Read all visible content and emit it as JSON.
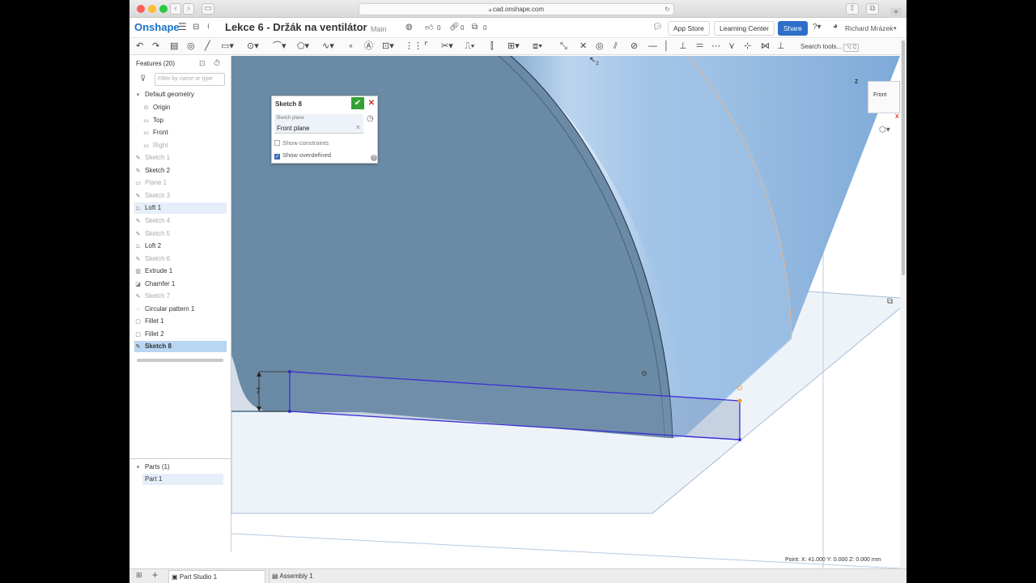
{
  "browser": {
    "url": "cad.onshape.com"
  },
  "header": {
    "logo": "Onshape",
    "title": "Lekce 6 - Držák na ventilátor",
    "branch": "Main",
    "likes": "0",
    "links": "0",
    "copies": "0",
    "app_store": "App Store",
    "learning_center": "Learning Center",
    "share": "Share",
    "user": "Richard Mrázek"
  },
  "toolbar": {
    "search_placeholder": "Search tools...",
    "search_shortcut": "⌥ C",
    "cursor_subscript": "2"
  },
  "features": {
    "title": "Features (20)",
    "filter_placeholder": "Filter by name or type",
    "default_geometry": "Default geometry",
    "items": [
      {
        "label": "Origin",
        "icon": "origin-icon",
        "state": "normal",
        "indent": 2
      },
      {
        "label": "Top",
        "icon": "plane-icon",
        "state": "normal",
        "indent": 2
      },
      {
        "label": "Front",
        "icon": "plane-icon",
        "state": "normal",
        "indent": 2
      },
      {
        "label": "Right",
        "icon": "plane-icon",
        "state": "dim",
        "indent": 2
      },
      {
        "label": "Sketch 1",
        "icon": "sketch-icon",
        "state": "dim",
        "indent": 0
      },
      {
        "label": "Sketch 2",
        "icon": "sketch-icon",
        "state": "normal",
        "indent": 0
      },
      {
        "label": "Plane 1",
        "icon": "plane-icon",
        "state": "dim",
        "indent": 0
      },
      {
        "label": "Sketch 3",
        "icon": "sketch-icon",
        "state": "dim",
        "indent": 0
      },
      {
        "label": "Loft 1",
        "icon": "loft-icon",
        "state": "hl",
        "indent": 0
      },
      {
        "label": "Sketch 4",
        "icon": "sketch-icon",
        "state": "dim",
        "indent": 0
      },
      {
        "label": "Sketch 5",
        "icon": "sketch-icon",
        "state": "dim",
        "indent": 0
      },
      {
        "label": "Loft 2",
        "icon": "loft-icon",
        "state": "normal",
        "indent": 0
      },
      {
        "label": "Sketch 6",
        "icon": "sketch-icon",
        "state": "dim",
        "indent": 0
      },
      {
        "label": "Extrude 1",
        "icon": "extrude-icon",
        "state": "normal",
        "indent": 0
      },
      {
        "label": "Chamfer 1",
        "icon": "chamfer-icon",
        "state": "normal",
        "indent": 0
      },
      {
        "label": "Sketch 7",
        "icon": "sketch-icon",
        "state": "dim",
        "indent": 0
      },
      {
        "label": "Circular pattern 1",
        "icon": "pattern-icon",
        "state": "normal",
        "indent": 0
      },
      {
        "label": "Fillet 1",
        "icon": "fillet-icon",
        "state": "normal",
        "indent": 0
      },
      {
        "label": "Fillet 2",
        "icon": "fillet-icon",
        "state": "normal",
        "indent": 0
      },
      {
        "label": "Sketch 8",
        "icon": "sketch-icon",
        "state": "sel",
        "indent": 0
      }
    ]
  },
  "parts": {
    "title": "Parts (1)",
    "items": [
      "Part 1"
    ]
  },
  "dialog": {
    "title": "Sketch 8",
    "plane_label": "Sketch plane",
    "plane_value": "Front plane",
    "show_constraints": "Show constraints",
    "show_overdefined": "Show overdefined"
  },
  "viewport": {
    "dimension": "7",
    "view_cube_label": "Front",
    "axis_z": "Z",
    "axis_x": "X"
  },
  "status": {
    "text": "Point: X: 41.000  Y: 0.000  Z: 0.000 mm"
  },
  "tabs": [
    {
      "label": "Part Studio 1",
      "active": true
    },
    {
      "label": "Assembly 1",
      "active": false
    }
  ]
}
